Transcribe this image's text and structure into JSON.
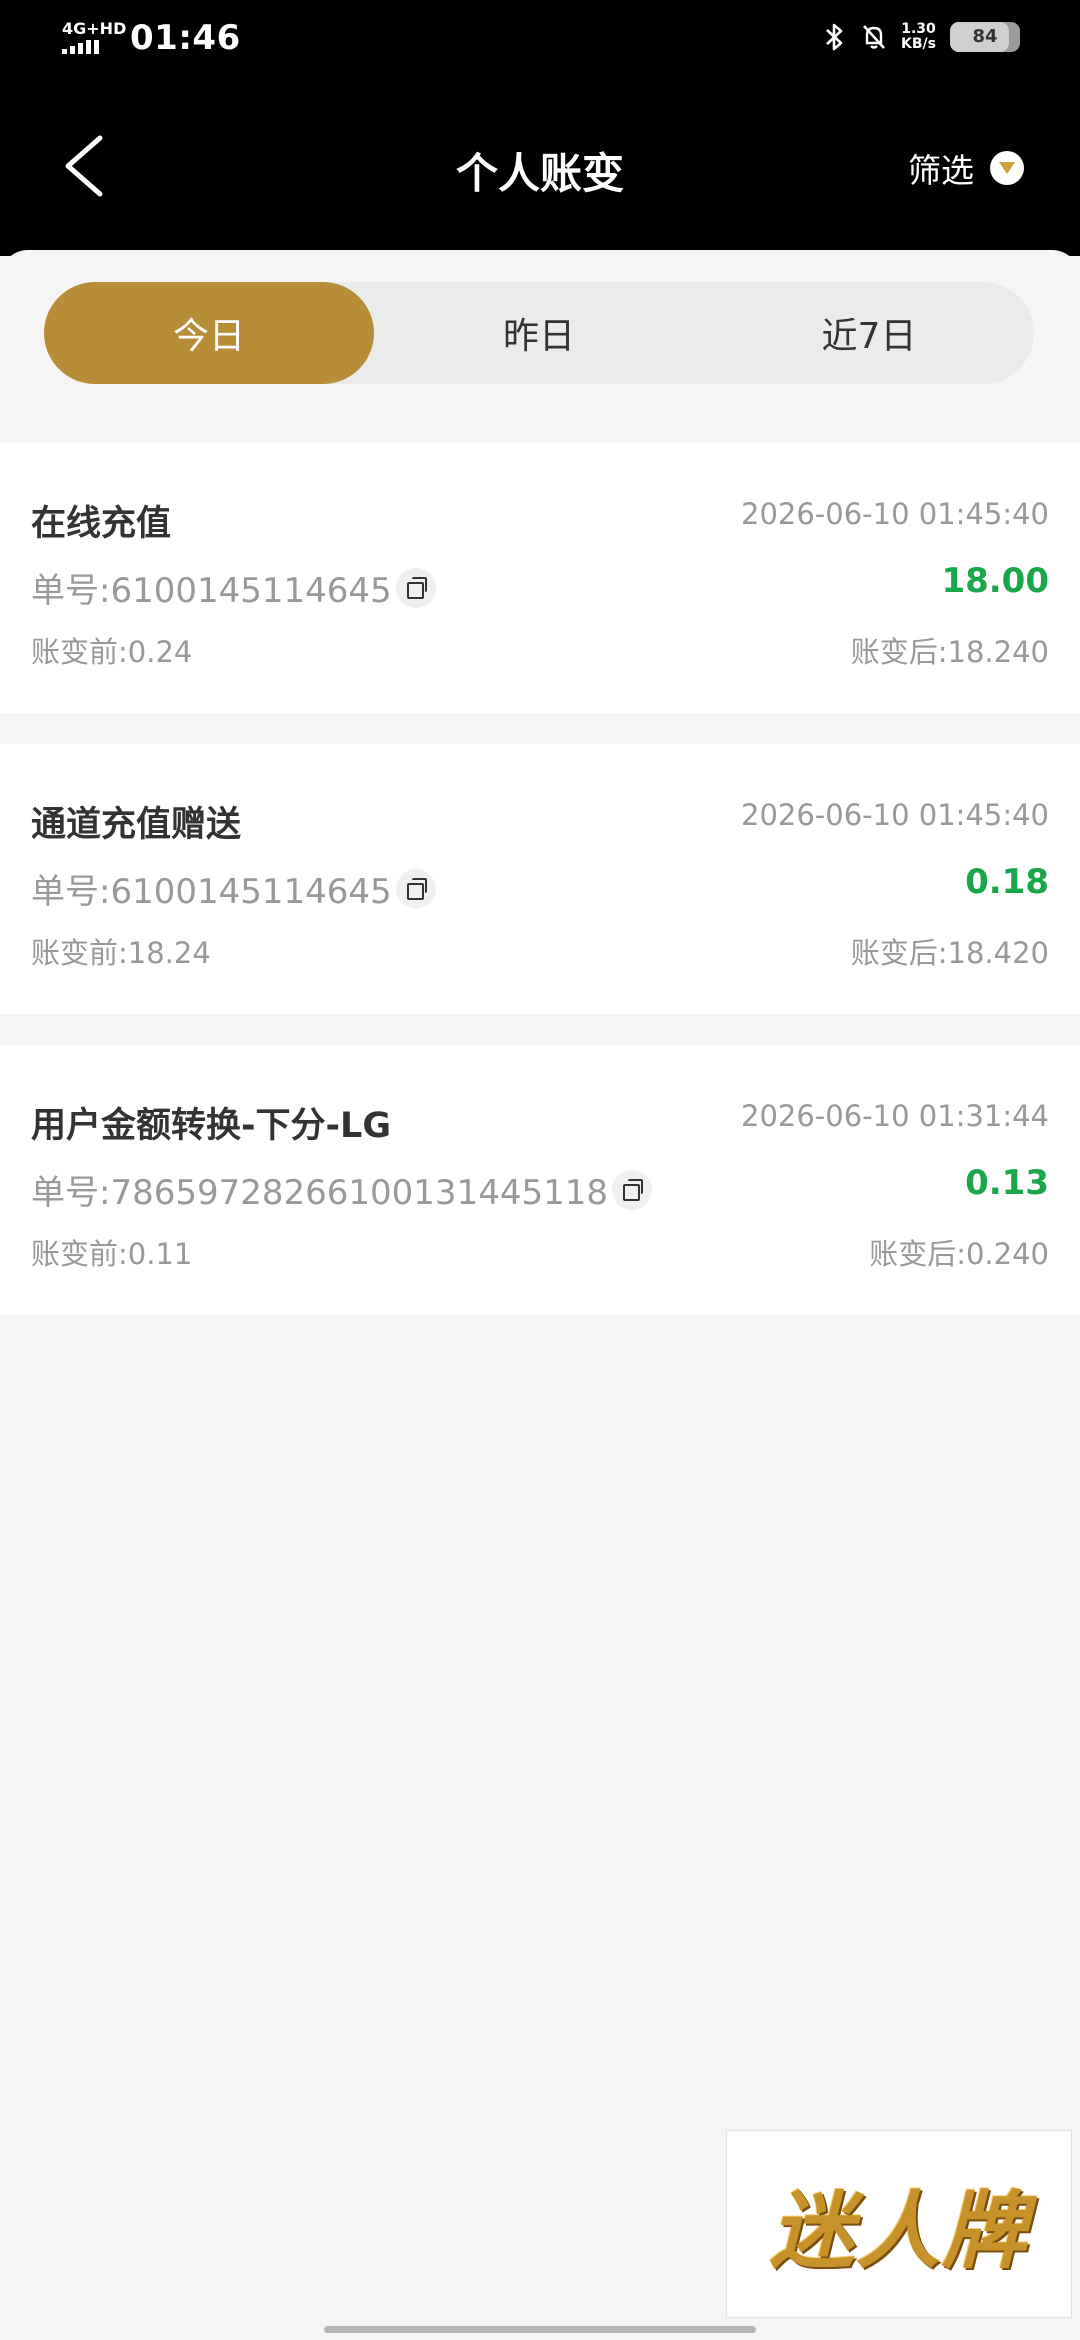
{
  "status_bar": {
    "network": "4G+HD",
    "time": "01:46",
    "speed_value": "1.30",
    "speed_unit": "KB/s",
    "battery": "84",
    "battery_level": 0.84
  },
  "header": {
    "title": "个人账变",
    "filter_label": "筛选",
    "back_icon": "chevron-left-icon",
    "filter_icon": "dropdown-circle-icon"
  },
  "tabs": [
    {
      "label": "今日",
      "active": true
    },
    {
      "label": "昨日",
      "active": false
    },
    {
      "label": "近7日",
      "active": false
    }
  ],
  "transactions": [
    {
      "title": "在线充值",
      "time": "2026-06-10 01:45:40",
      "order": "单号:6100145114645",
      "amount": "18.00",
      "before": "账变前:0.24",
      "after": "账变后:18.240"
    },
    {
      "title": "通道充值赠送",
      "time": "2026-06-10 01:45:40",
      "order": "单号:6100145114645",
      "amount": "0.18",
      "before": "账变前:18.24",
      "after": "账变后:18.420"
    },
    {
      "title": "用户金额转换-下分-LG",
      "time": "2026-06-10 01:31:44",
      "order": "单号:78659728266100131445118",
      "amount": "0.13",
      "before": "账变前:0.11",
      "after": "账变后:0.240"
    }
  ],
  "brand": {
    "text": "迷人牌"
  },
  "colors": {
    "accent": "#b78e37",
    "amount_positive": "#1aa64b",
    "header_bg": "#000000",
    "page_bg": "#f5f5f5"
  }
}
